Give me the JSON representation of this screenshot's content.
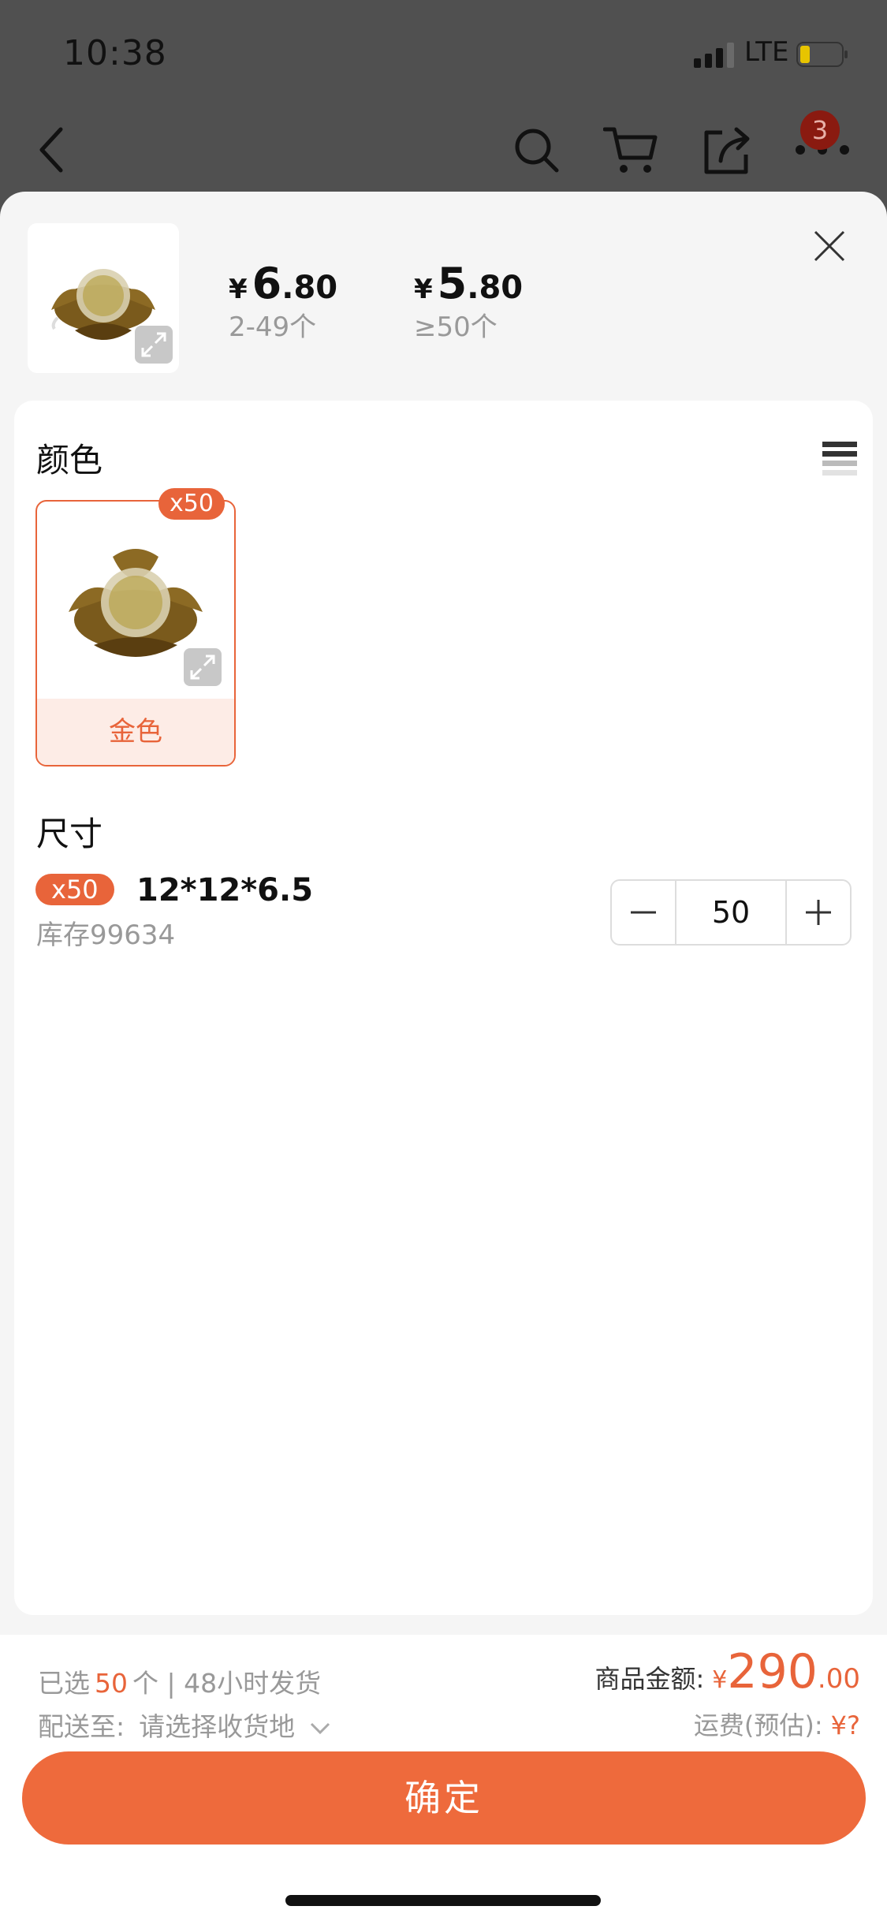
{
  "status_bar": {
    "time": "10:38",
    "network": "LTE"
  },
  "nav": {
    "cart_badge": "3"
  },
  "product": {
    "prices": [
      {
        "currency": "¥",
        "integer": "6",
        "decimal": ".80",
        "range": "2-49个"
      },
      {
        "currency": "¥",
        "integer": "5",
        "decimal": ".80",
        "range": "≥50个"
      }
    ]
  },
  "color_section": {
    "title": "颜色",
    "options": [
      {
        "label": "金色",
        "count": "x50",
        "selected": true
      }
    ]
  },
  "size_section": {
    "title": "尺寸",
    "items": [
      {
        "count": "x50",
        "name": "12*12*6.5",
        "stock": "库存99634",
        "quantity": "50"
      }
    ]
  },
  "footer": {
    "selected_prefix": "已选",
    "selected_count": "50",
    "selected_suffix": "个 | 48小时发货",
    "ship_to_label": "配送至:",
    "ship_to_value": "请选择收货地",
    "amount_label": "商品金额:",
    "amount_currency": "¥",
    "amount_integer": "290",
    "amount_decimal": ".00",
    "freight_label": "运费(预估):",
    "freight_value": "¥?",
    "confirm_label": "确定"
  },
  "colors": {
    "accent": "#ee6a3c",
    "accent_text": "#e8643a",
    "overlay": "#505050"
  }
}
